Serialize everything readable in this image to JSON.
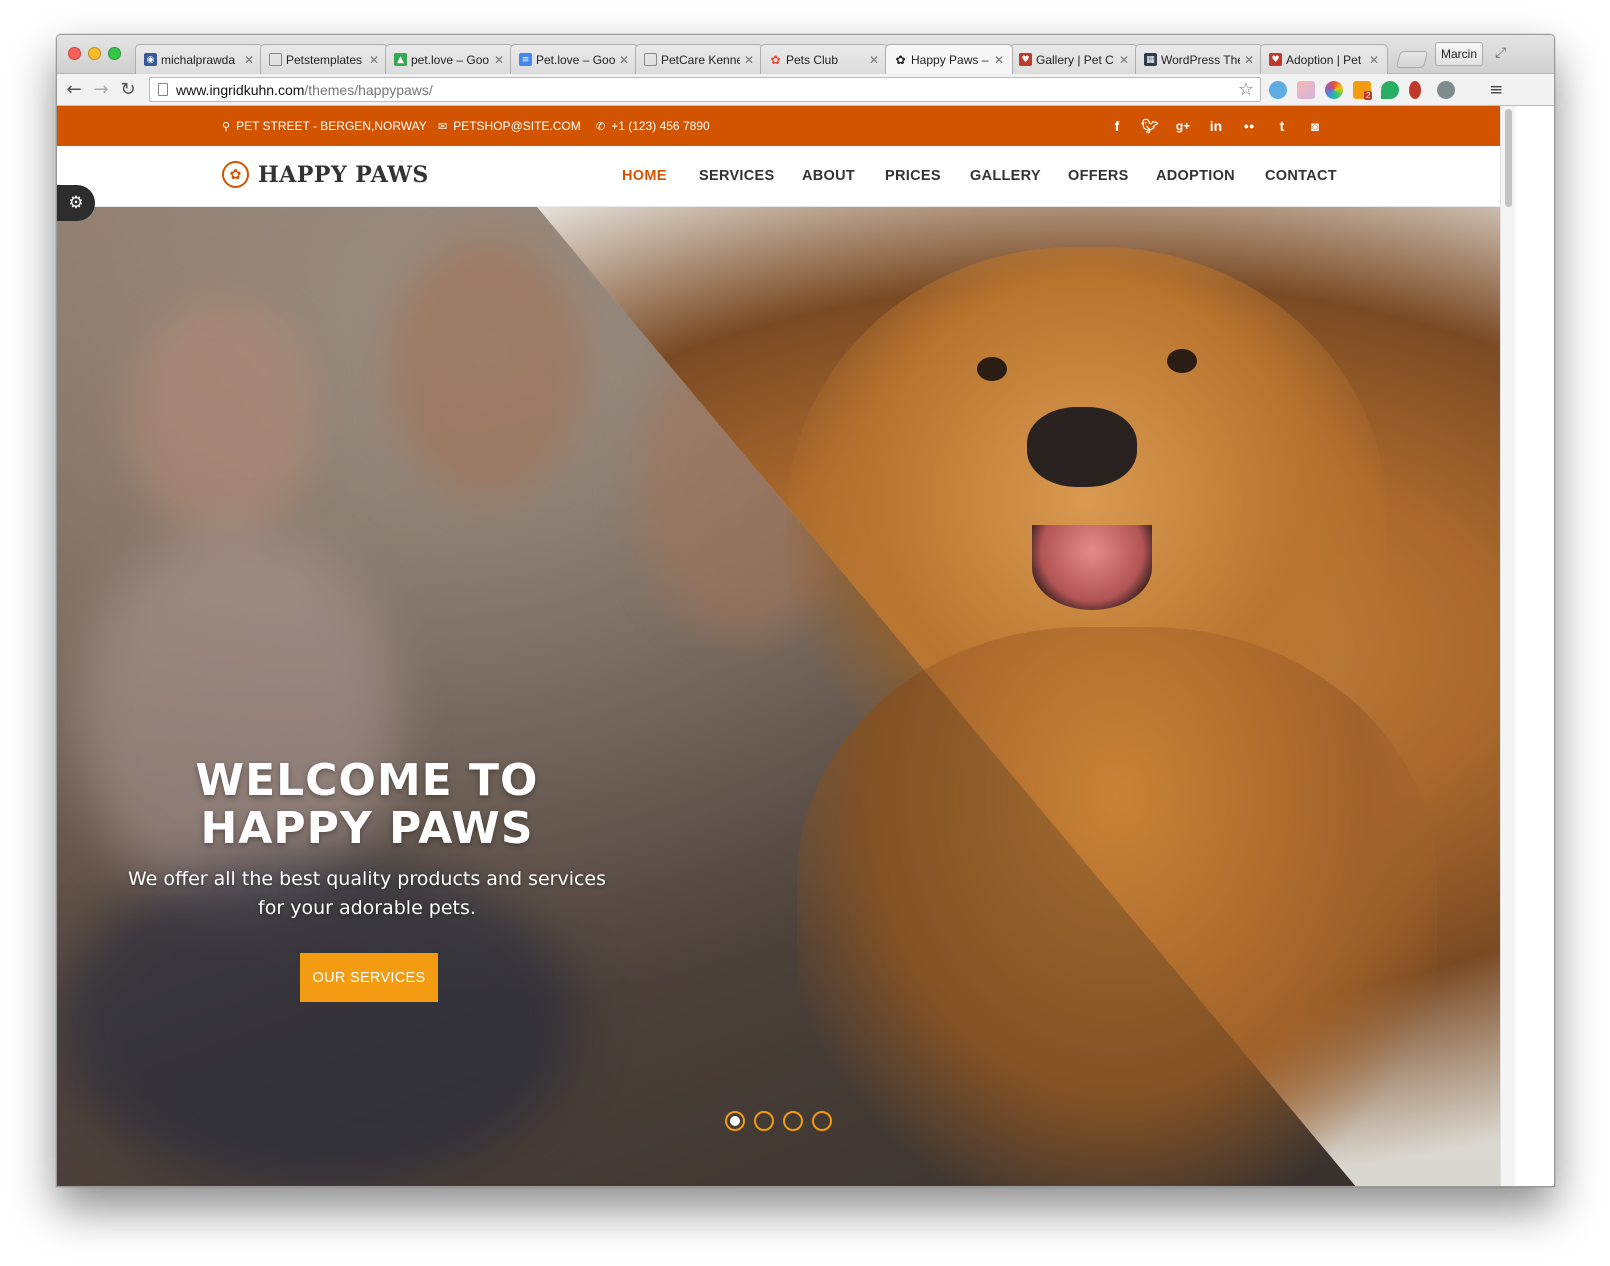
{
  "browser": {
    "tabs": [
      {
        "title": "michalprawda",
        "icon": "github-icon",
        "color": "#3b5998"
      },
      {
        "title": "Petstemplates",
        "icon": "page-icon",
        "color": "#ffffff"
      },
      {
        "title": "pet.love – Goo",
        "icon": "drive-icon",
        "color": "#34a853"
      },
      {
        "title": "Pet.love – Goo",
        "icon": "docs-icon",
        "color": "#4285f4"
      },
      {
        "title": "PetCare Kenne",
        "icon": "page-icon",
        "color": "#ffffff"
      },
      {
        "title": "Pets Club",
        "icon": "paw-icon",
        "color": "#e74c3c"
      },
      {
        "title": "Happy Paws –",
        "icon": "paw-icon",
        "color": "#222222"
      },
      {
        "title": "Gallery | Pet C",
        "icon": "heart-icon",
        "color": "#c0392b"
      },
      {
        "title": "WordPress The",
        "icon": "grid-icon",
        "color": "#2c3e50"
      },
      {
        "title": "Adoption | Pet",
        "icon": "heart-icon",
        "color": "#c0392b"
      }
    ],
    "profile_label": "Marcin",
    "url_host": "www.ingridkuhn.com",
    "url_path": "/themes/happypaws/",
    "rss_badge": "2"
  },
  "site": {
    "topbar": {
      "address": "PET STREET - BERGEN,NORWAY",
      "email": "PETSHOP@SITE.COM",
      "phone": "+1 (123) 456 7890",
      "social": [
        "f",
        "t",
        "g+",
        "in",
        "fl",
        "t",
        "ig"
      ]
    },
    "logo_text": "HAPPY PAWS",
    "nav": [
      "HOME",
      "SERVICES",
      "ABOUT",
      "PRICES",
      "GALLERY",
      "OFFERS",
      "ADOPTION",
      "CONTACT"
    ],
    "active_nav": "HOME",
    "hero": {
      "title_line1": "WELCOME TO",
      "title_line2": "HAPPY PAWS",
      "subtitle_line1": "We offer all the best quality products and services",
      "subtitle_line2": "for your adorable pets.",
      "button": "OUR SERVICES",
      "slide_count": 4,
      "active_slide": 1
    },
    "colors": {
      "brand": "#d35400",
      "accent": "#f39c12"
    }
  }
}
